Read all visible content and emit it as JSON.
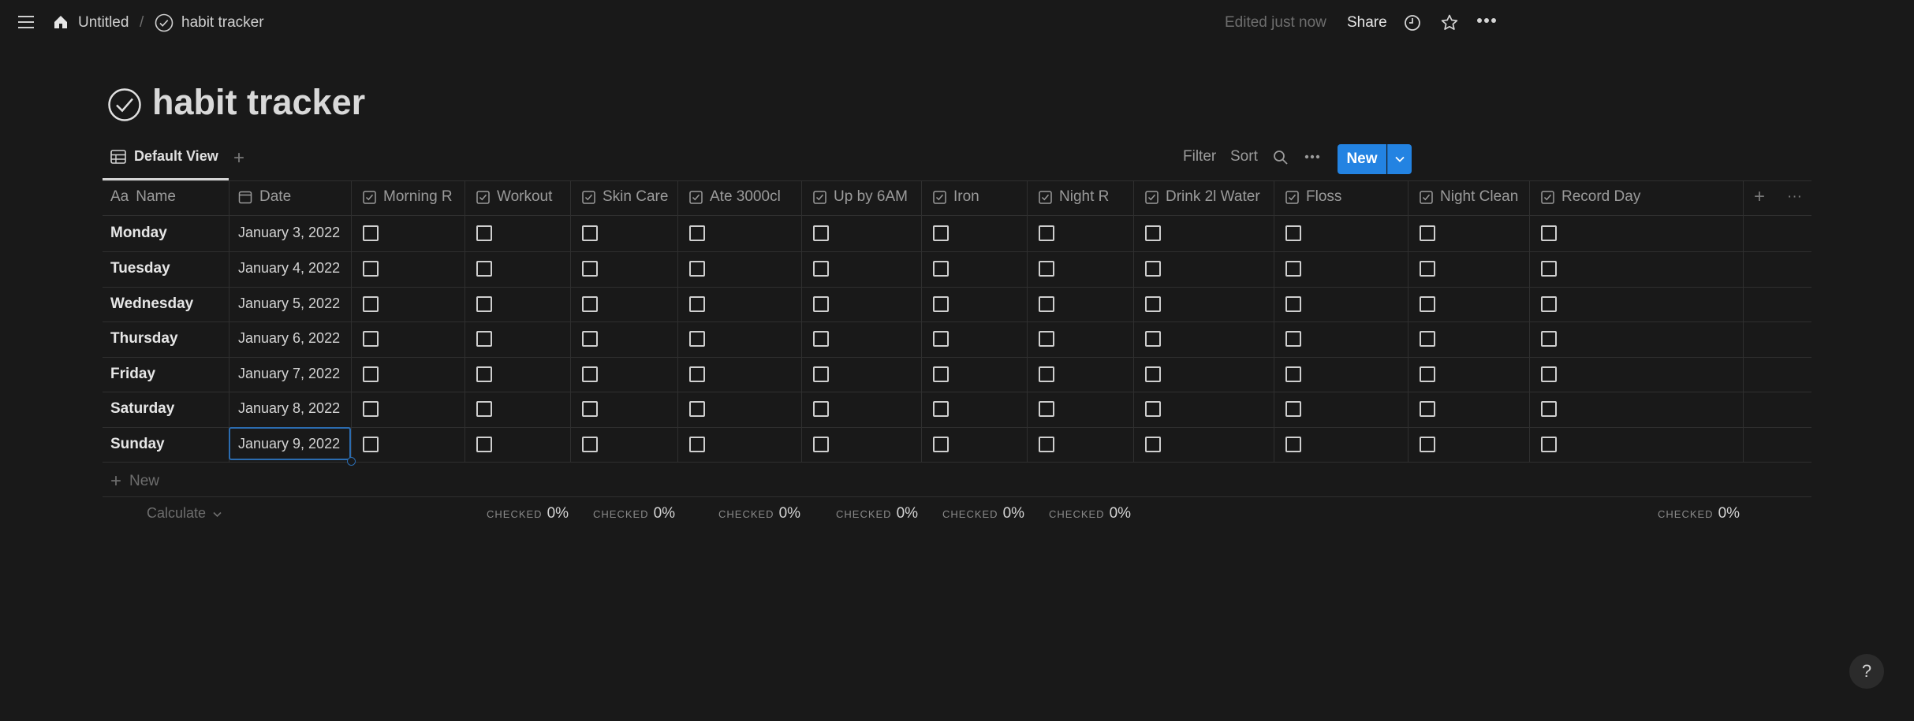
{
  "breadcrumb": {
    "home": "Untitled",
    "separator": "/",
    "page": "habit tracker"
  },
  "topbar": {
    "edited": "Edited just now",
    "share": "Share"
  },
  "page": {
    "title": "habit tracker"
  },
  "view": {
    "name": "Default View",
    "add": "+"
  },
  "toolbar": {
    "filter": "Filter",
    "sort": "Sort",
    "new": "New"
  },
  "table": {
    "name_header": "Name",
    "name_header_prefix": "Aa",
    "date_header": "Date",
    "habit_headers": [
      "Morning R",
      "Workout",
      "Skin Care",
      "Ate 3000cl",
      "Up by 6AM",
      "Iron",
      "Night R",
      "Drink 2l Water",
      "Floss",
      "Night Clean",
      "Record Day"
    ],
    "rows": [
      {
        "name": "Monday",
        "date": "January 3, 2022"
      },
      {
        "name": "Tuesday",
        "date": "January 4, 2022"
      },
      {
        "name": "Wednesday",
        "date": "January 5, 2022"
      },
      {
        "name": "Thursday",
        "date": "January 6, 2022"
      },
      {
        "name": "Friday",
        "date": "January 7, 2022"
      },
      {
        "name": "Saturday",
        "date": "January 8, 2022"
      },
      {
        "name": "Sunday",
        "date": "January 9, 2022"
      }
    ],
    "new_row": "New",
    "add_column": "+",
    "more": "···"
  },
  "footer": {
    "calculate": "Calculate",
    "stats": [
      {
        "key": "CHECKED",
        "value": "0%"
      },
      {
        "key": "CHECKED",
        "value": "0%"
      },
      {
        "key": "CHECKED",
        "value": "0%"
      },
      {
        "key": "CHECKED",
        "value": "0%"
      },
      {
        "key": "CHECKED",
        "value": "0%"
      },
      {
        "key": "CHECKED",
        "value": "0%"
      },
      {
        "key": "CHECKED",
        "value": "0%"
      }
    ]
  },
  "help": "?",
  "colors": {
    "background": "#191919",
    "accent": "#2383e2",
    "focus": "#2b6cb0"
  }
}
